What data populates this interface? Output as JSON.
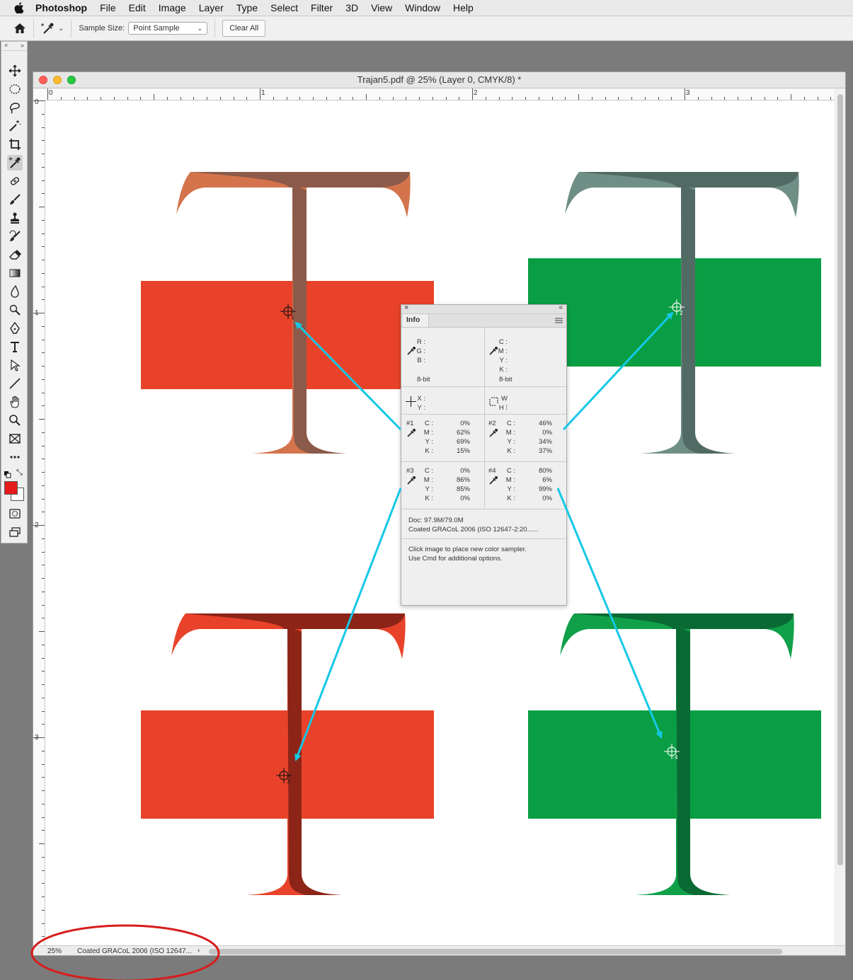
{
  "menubar": {
    "app_name": "Photoshop",
    "items": [
      "File",
      "Edit",
      "Image",
      "Layer",
      "Type",
      "Select",
      "Filter",
      "3D",
      "View",
      "Window",
      "Help"
    ]
  },
  "options_bar": {
    "sample_size_label": "Sample Size:",
    "sample_size_value": "Point Sample",
    "clear_all_label": "Clear All"
  },
  "document": {
    "title": "Trajan5.pdf @ 25% (Layer 0, CMYK/8) *",
    "ruler_h_labels": [
      "0",
      "1",
      "2",
      "3"
    ],
    "ruler_v_labels": [
      "0",
      "1",
      "2",
      "3"
    ],
    "status_zoom": "25%",
    "status_profile": "Coated GRACoL 2006 (ISO 12647...",
    "status_arrow": "›"
  },
  "colors": {
    "toolbox_foreground": "#e51a1a",
    "red_rect": "#e8432a",
    "green_rect": "#0a9e44",
    "t_copper_light": "#d4744c",
    "t_copper_dark": "#8b5a4a",
    "t_sage_light": "#6f8f86",
    "t_sage_dark": "#516a64",
    "t_red_light": "#e8432a",
    "t_red_dark": "#8c2418",
    "t_green_light": "#10a04a",
    "t_green_dark": "#0a6a33",
    "arrow": "#14c8e6",
    "highlight_ellipse": "#d81c1c"
  },
  "info_panel": {
    "tab": "Info",
    "rgb_labels": [
      "R :",
      "G :",
      "B :"
    ],
    "rgb_depth": "8-bit",
    "cmyk_labels": [
      "C :",
      "M :",
      "Y :",
      "K :"
    ],
    "cmyk_depth": "8-bit",
    "xy_labels": [
      "X :",
      "Y :"
    ],
    "wh_labels": [
      "W :",
      "H :"
    ],
    "samplers": [
      {
        "id": "#1",
        "labels": [
          "C :",
          "M :",
          "Y :",
          "K :"
        ],
        "values": [
          "0%",
          "62%",
          "69%",
          "15%"
        ]
      },
      {
        "id": "#2",
        "labels": [
          "C :",
          "M :",
          "Y :",
          "K :"
        ],
        "values": [
          "46%",
          "0%",
          "34%",
          "37%"
        ]
      },
      {
        "id": "#3",
        "labels": [
          "C :",
          "M :",
          "Y :",
          "K :"
        ],
        "values": [
          "0%",
          "86%",
          "85%",
          "0%"
        ]
      },
      {
        "id": "#4",
        "labels": [
          "C :",
          "M :",
          "Y :",
          "K :"
        ],
        "values": [
          "80%",
          "6%",
          "99%",
          "0%"
        ]
      }
    ],
    "doc_size": "Doc: 97.9M/79.0M",
    "doc_profile": "Coated GRACoL 2006 (ISO 12647-2:20......",
    "hint_line1": "Click image to place new color sampler.",
    "hint_line2": "Use Cmd for additional options."
  },
  "sampler_markers": [
    "1",
    "2",
    "3",
    "4"
  ]
}
